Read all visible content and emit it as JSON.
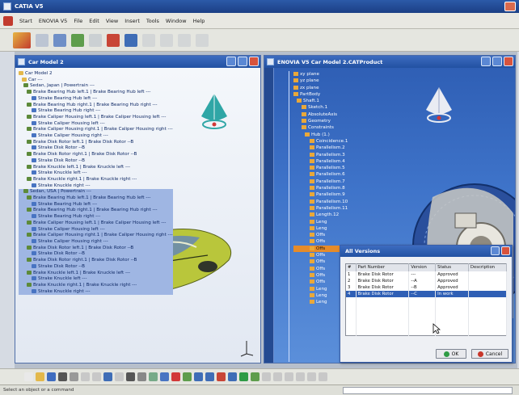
{
  "app": {
    "title": "CATIA V5"
  },
  "menu": [
    "Start",
    "ENOVIA V5",
    "File",
    "Edit",
    "View",
    "Insert",
    "Tools",
    "Window",
    "Help"
  ],
  "left_window": {
    "title": "Car Model 2",
    "tree": [
      "Car Model 2",
      "Car ---",
      "Sedan, Japan | Powertrain ---",
      "Brake Bearing Hub left.1 | Brake Bearing Hub left ---",
      "Strake Bearing Hub left ---",
      "Brake Bearing Hub right.1 | Brake Bearing Hub right ---",
      "Strake Bearing Hub right ---",
      "Brake Caliper Housing left.1 | Brake Caliper Housing left ---",
      "Strake Caliper Housing left ---",
      "Brake Caliper Housing right.1 | Brake Caliper Housing right ---",
      "Strake Caliper Housing right ---",
      "Brake Disk Rotor left.1 | Brake Disk Rotor --B",
      "Strake Disk Rotor --B",
      "Brake Disk Rotor right.1 | Brake Disk Rotor --B",
      "Strake Disk Rotor --B",
      "Brake Knuckle left.1 | Brake Knuckle left ---",
      "Strake Knuckle left ---",
      "Brake Knuckle right.1 | Brake Knuckle right ---",
      "Strake Knuckle right ---",
      "Sedan, USA | Powertrain ---",
      "Brake Bearing Hub left.1 | Brake Bearing Hub left ---",
      "Strake Bearing Hub left ---",
      "Brake Bearing Hub right.1 | Brake Bearing Hub right ---",
      "Strake Bearing Hub right ---",
      "Brake Caliper Housing left.1 | Brake Caliper Housing left ---",
      "Strake Caliper Housing left ---",
      "Brake Caliper Housing right.1 | Brake Caliper Housing right ---",
      "Strake Caliper Housing right ---",
      "Brake Disk Rotor left.1 | Brake Disk Rotor --B",
      "Strake Disk Rotor --B",
      "Brake Disk Rotor right.1 | Brake Disk Rotor --B",
      "Strake Disk Rotor --B",
      "Brake Knuckle left.1 | Brake Knuckle left ---",
      "Strake Knuckle left ---",
      "Brake Knuckle right.1 | Brake Knuckle right ---",
      "Strake Knuckle right ---"
    ]
  },
  "right_window": {
    "title": "ENOVIA V5 Car Model 2.CATProduct",
    "tree": [
      "xy plane",
      "yz plane",
      "zx plane",
      "PartBody",
      "Shaft.1",
      "Sketch.1",
      "AbsoluteAxis",
      "Geometry",
      "Constraints",
      "Hub (1.)",
      "Coincidence.1",
      "Parallelism.2",
      "Parallelism.3",
      "Parallelism.4",
      "Parallelism.5",
      "Parallelism.6",
      "Parallelism.7",
      "Parallelism.8",
      "Parallelism.9",
      "Parallelism.10",
      "Parallelism.11",
      "Length.12",
      "Leng",
      "Leng",
      "Offs",
      "Offs",
      "Offs",
      "Offs",
      "Offs",
      "Offs",
      "Offs",
      "Offs",
      "Leng",
      "Leng",
      "Leng"
    ],
    "highlight_index": 26
  },
  "dialog": {
    "title": "All Versions",
    "columns": [
      "#",
      "Part Number",
      "Version",
      "Status",
      "Description"
    ],
    "rows": [
      [
        "1",
        "Brake Disk Rotor",
        "---",
        "Approved",
        ""
      ],
      [
        "2",
        "Brake Disk Rotor",
        "--A",
        "Approved",
        ""
      ],
      [
        "3",
        "Brake Disk Rotor",
        "--B",
        "Approved",
        ""
      ],
      [
        "4",
        "Brake Disk Rotor",
        "--C",
        "In work",
        ""
      ]
    ],
    "selected_row": 3,
    "ok_label": "OK",
    "cancel_label": "Cancel"
  },
  "status": {
    "text": "Select an object or a command"
  },
  "colors": {
    "title_blue": "#2251a2",
    "highlight_orange": "#e58b2a",
    "viewport_blue": "#3e73c9",
    "car_green": "#b8c83a"
  }
}
